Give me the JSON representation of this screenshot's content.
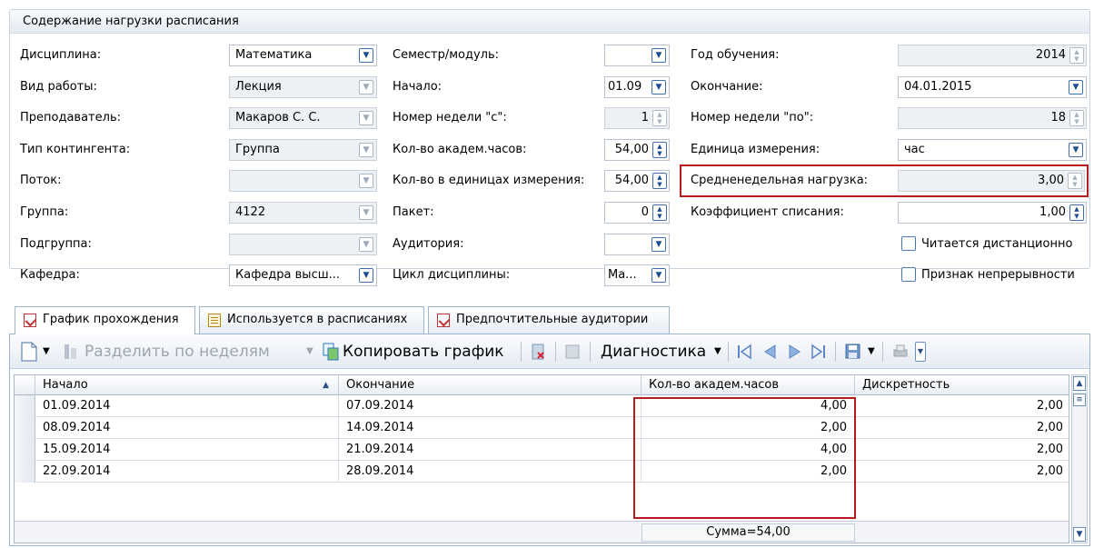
{
  "group": {
    "title": "Содержание нагрузки расписания"
  },
  "form": {
    "discipline": {
      "label": "Дисциплина:",
      "value": "Математика"
    },
    "semester": {
      "label": "Семестр/модуль:",
      "value": ""
    },
    "year": {
      "label": "Год обучения:",
      "value": "2014"
    },
    "work_type": {
      "label": "Вид работы:",
      "value": "Лекция"
    },
    "start": {
      "label": "Начало:",
      "value": "01.09"
    },
    "end": {
      "label": "Окончание:",
      "value": "04.01.2015"
    },
    "teacher": {
      "label": "Преподаватель:",
      "value": "Макаров С. С."
    },
    "week_from": {
      "label": "Номер недели \"с\":",
      "value": "1"
    },
    "week_to": {
      "label": "Номер недели \"по\":",
      "value": "18"
    },
    "contingent": {
      "label": "Тип контингента:",
      "value": "Группа"
    },
    "acad_hours": {
      "label": "Кол-во академ.часов:",
      "value": "54,00"
    },
    "unit": {
      "label": "Единица измерения:",
      "value": "час"
    },
    "stream": {
      "label": "Поток:",
      "value": ""
    },
    "units_count": {
      "label": "Кол-во в единицах измерения:",
      "value": "54,00"
    },
    "weekly_load": {
      "label": "Средненедельная нагрузка:",
      "value": "3,00"
    },
    "group_field": {
      "label": "Группа:",
      "value": "4122"
    },
    "package": {
      "label": "Пакет:",
      "value": "0"
    },
    "writeoff": {
      "label": "Коэффициент списания:",
      "value": "1,00"
    },
    "subgroup": {
      "label": "Подгруппа:",
      "value": ""
    },
    "auditorium": {
      "label": "Аудитория:",
      "value": ""
    },
    "remote": {
      "label": "Читается дистанционно"
    },
    "department": {
      "label": "Кафедра:",
      "value": "Кафедра высш..."
    },
    "cycle": {
      "label": "Цикл дисциплины:",
      "value": "Ма..."
    },
    "continuity": {
      "label": "Признак непрерывности"
    }
  },
  "tabs": [
    {
      "label": "График прохождения"
    },
    {
      "label": "Используется в расписаниях"
    },
    {
      "label": "Предпочтительные аудитории"
    }
  ],
  "toolbar": {
    "split": "Разделить по неделям",
    "copy": "Копировать график",
    "diagnostics": "Диагностика"
  },
  "table": {
    "columns": [
      "Начало",
      "Окончание",
      "Кол-во академ.часов",
      "Дискретность"
    ],
    "rows": [
      [
        "01.09.2014",
        "07.09.2014",
        "4,00",
        "2,00"
      ],
      [
        "08.09.2014",
        "14.09.2014",
        "2,00",
        "2,00"
      ],
      [
        "15.09.2014",
        "21.09.2014",
        "4,00",
        "2,00"
      ],
      [
        "22.09.2014",
        "28.09.2014",
        "2,00",
        "2,00"
      ]
    ],
    "footer_sum": "Сумма=54,00"
  },
  "colors": {
    "highlight": "#b71c1c",
    "accent": "#3f6fb0"
  }
}
